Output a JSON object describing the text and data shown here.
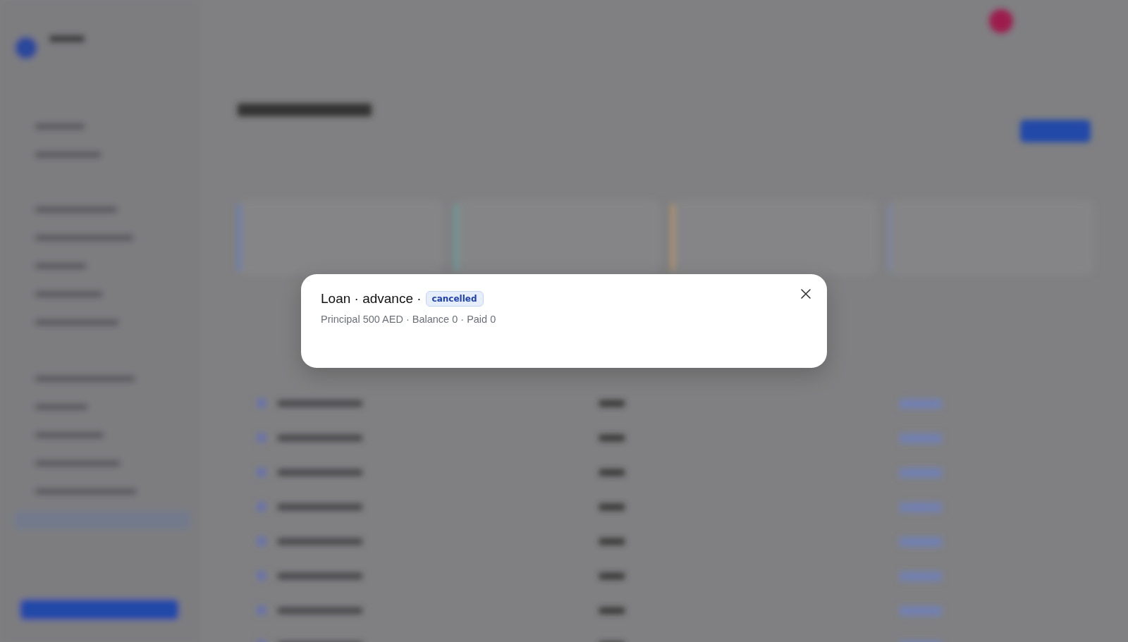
{
  "dialog": {
    "title": "Loan · advance ·",
    "status": "cancelled",
    "summary": "Principal 500 AED · Balance 0 · Paid 0"
  }
}
